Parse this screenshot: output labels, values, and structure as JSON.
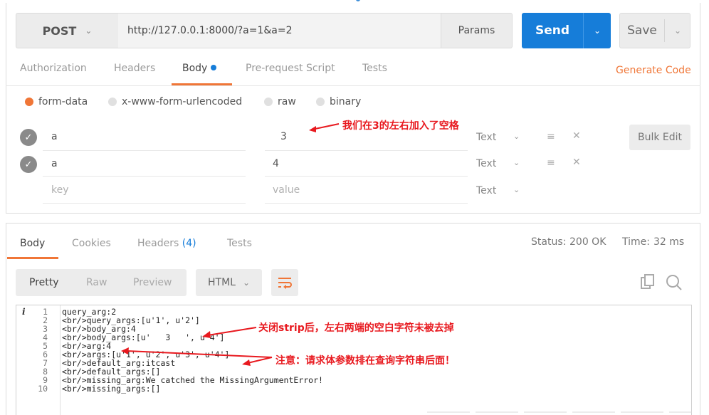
{
  "request": {
    "method": "POST",
    "url": "http://127.0.0.1:8000/?a=1&a=2",
    "params_label": "Params",
    "send_label": "Send",
    "save_label": "Save"
  },
  "request_tabs": [
    "Authorization",
    "Headers",
    "Body",
    "Pre-request Script",
    "Tests"
  ],
  "generate_code_label": "Generate Code",
  "body_modes": [
    {
      "label": "form-data",
      "selected": true
    },
    {
      "label": "x-www-form-urlencoded",
      "selected": false
    },
    {
      "label": "raw",
      "selected": false
    },
    {
      "label": "binary",
      "selected": false
    }
  ],
  "form_rows": [
    {
      "key": "a",
      "value": "3",
      "type": "Text"
    },
    {
      "key": "a",
      "value": "4",
      "type": "Text"
    },
    {
      "key_placeholder": "key",
      "value_placeholder": "value",
      "type": "Text"
    }
  ],
  "bulk_edit_label": "Bulk Edit",
  "annotations": {
    "spaces_note": "我们在3的左右加入了空格",
    "strip_note": "关闭strip后，左右两端的空白字符未被去掉",
    "order_note": "注意：请求体参数排在查询字符串后面！"
  },
  "response": {
    "tabs": [
      "Body",
      "Cookies",
      "Headers",
      "Tests"
    ],
    "headers_count": "(4)",
    "status_label": "Status:",
    "status_value": "200 OK",
    "time_label": "Time:",
    "time_value": "32 ms",
    "view_modes": [
      "Pretty",
      "Raw",
      "Preview"
    ],
    "format": "HTML",
    "info_glyph": "i",
    "code_lines": [
      "query_arg:2",
      "<br/>query_args:[u'1', u'2']",
      "<br/>body_arg:4",
      "<br/>body_args:[u'   3   ', u'4']",
      "<br/>arg:4",
      "<br/>args:[u'1', u'2', u'3', u'4']",
      "<br/>default_arg:itcast",
      "<br/>default_args:[]",
      "<br/>missing_arg:We catched the MissingArgumentError!",
      "<br/>missing_args:[]"
    ]
  },
  "colors": {
    "accent": "#f07637",
    "primary": "#167dd9",
    "annotation": "#e8191f"
  }
}
